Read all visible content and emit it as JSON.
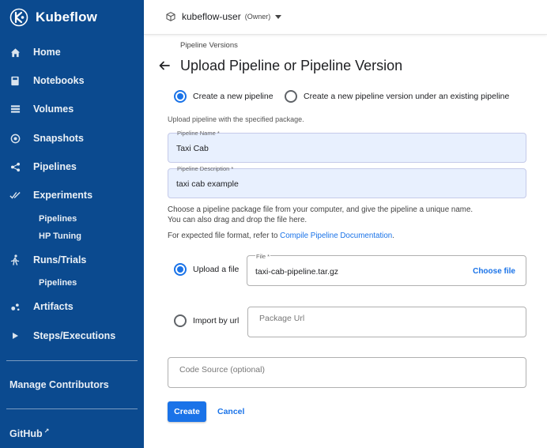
{
  "brand": {
    "name": "Kubeflow"
  },
  "sidebar": {
    "items": [
      {
        "label": "Home",
        "icon": "home-icon"
      },
      {
        "label": "Notebooks",
        "icon": "notebook-icon"
      },
      {
        "label": "Volumes",
        "icon": "volumes-icon"
      },
      {
        "label": "Snapshots",
        "icon": "snapshot-icon"
      },
      {
        "label": "Pipelines",
        "icon": "pipeline-icon"
      },
      {
        "label": "Experiments",
        "icon": "experiments-icon"
      },
      {
        "label": "Runs/Trials",
        "icon": "run-icon"
      },
      {
        "label": "Artifacts",
        "icon": "artifacts-icon"
      },
      {
        "label": "Steps/Executions",
        "icon": "play-icon"
      }
    ],
    "experiments_sub": [
      "Pipelines",
      "HP Tuning"
    ],
    "runs_sub": [
      "Pipelines"
    ],
    "manage_contributors": "Manage Contributors",
    "github": "GitHub"
  },
  "topbar": {
    "namespace": "kubeflow-user",
    "role": "(Owner)"
  },
  "page": {
    "breadcrumb": "Pipeline Versions",
    "title": "Upload Pipeline or Pipeline Version"
  },
  "form": {
    "radio_new_pipeline": "Create a new pipeline",
    "radio_new_version": "Create a new pipeline version under an existing pipeline",
    "upload_hint": "Upload pipeline with the specified package.",
    "pipeline_name_label": "Pipeline Name *",
    "pipeline_name_value": "Taxi Cab",
    "pipeline_description_label": "Pipeline Description *",
    "pipeline_description_value": "taxi cab example",
    "choose_hint_line1": "Choose a pipeline package file from your computer, and give the pipeline a unique name.",
    "choose_hint_line2": "You can also drag and drop the file here.",
    "format_hint_prefix": "For expected file format, refer to ",
    "format_hint_link": "Compile Pipeline Documentation",
    "format_hint_suffix": ".",
    "upload_file_label": "Upload a file",
    "file_field_label": "File *",
    "file_value": "taxi-cab-pipeline.tar.gz",
    "choose_file": "Choose file",
    "import_url_label": "Import by url",
    "package_url_placeholder": "Package Url",
    "code_source_placeholder": "Code Source (optional)",
    "create_button": "Create",
    "cancel_button": "Cancel"
  },
  "colors": {
    "sidebar": "#0b4a8f",
    "accent": "#1a73e8",
    "filled_field": "#e8f0fe"
  }
}
